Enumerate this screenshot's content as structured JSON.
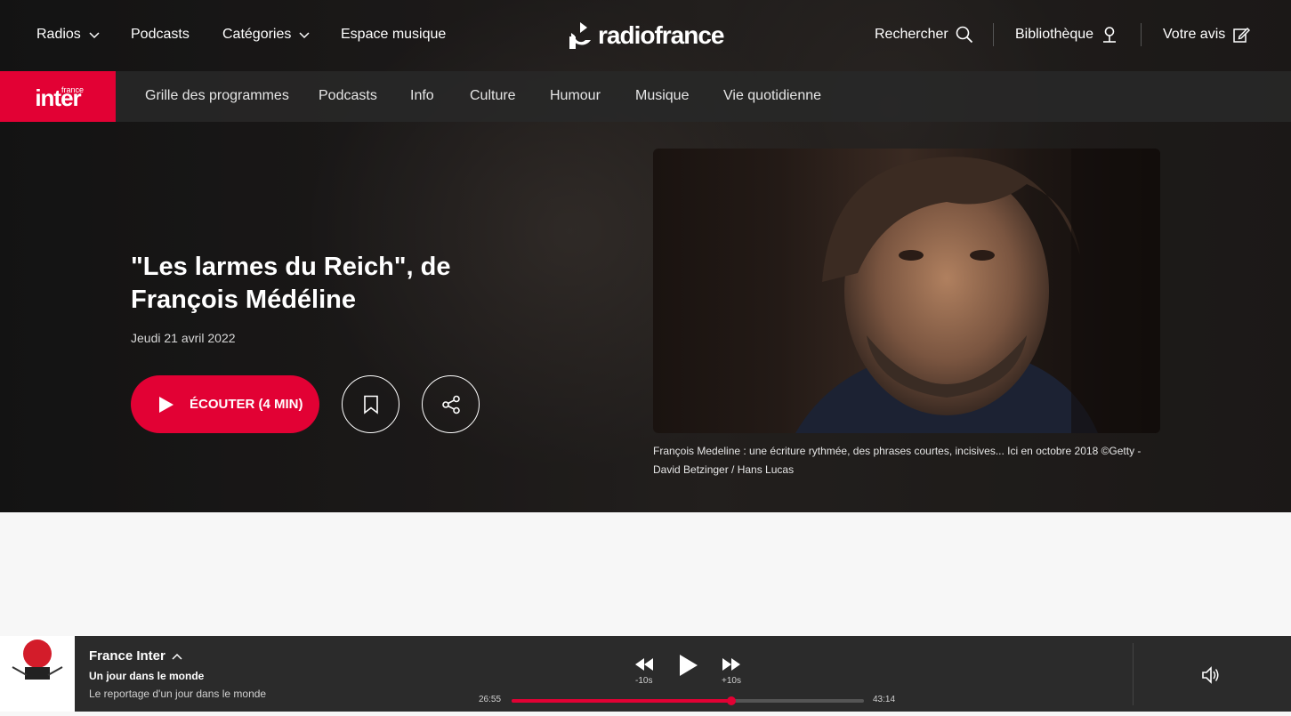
{
  "topnav": {
    "radios": "Radios",
    "podcasts": "Podcasts",
    "categories": "Catégories",
    "espace_musique": "Espace musique",
    "logo": "radiofrance",
    "search": "Rechercher",
    "library": "Bibliothèque",
    "feedback": "Votre avis"
  },
  "station": {
    "brand_small": "france",
    "brand_main": "inter",
    "accent": "#e20134"
  },
  "subnav": {
    "items": [
      "Grille des programmes",
      "Podcasts",
      "Info",
      "Culture",
      "Humour",
      "Musique",
      "Vie quotidienne"
    ]
  },
  "episode": {
    "title_line1": "\"Les larmes du Reich\", de",
    "title_line2": "François Médéline",
    "date": "Jeudi 21 avril 2022",
    "listen_label": "ÉCOUTER (4 MIN)",
    "caption": "François Medeline : une écriture rythmée, des phrases courtes, incisives... Ici en octobre 2018 ©Getty - David Betzinger / Hans Lucas"
  },
  "player": {
    "station": "France Inter",
    "show": "Un jour dans le monde",
    "episode": "Le reportage d'un jour dans le monde",
    "rewind_label": "-10s",
    "forward_label": "+10s",
    "elapsed": "26:55",
    "total": "43:14",
    "progress": 0.623
  }
}
